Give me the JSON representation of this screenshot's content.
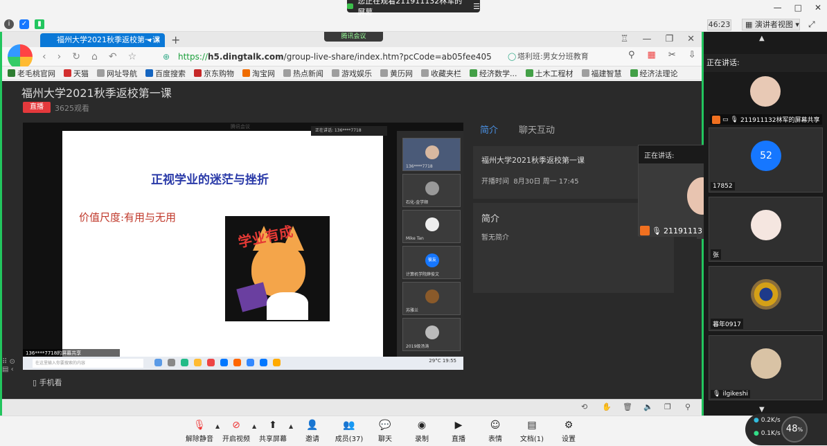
{
  "meeting": {
    "viewing_text": "您正在观看211911132林军的屏幕",
    "timer": "46:23",
    "speaker_view": "演讲者视图",
    "window_controls": [
      "—",
      "□",
      "✕"
    ]
  },
  "browser": {
    "tab_title": "福州大学2021秋季返校第一课",
    "tencent_meeting_pill": "腾讯会议",
    "url_prefix": "https://",
    "url_host": "h5.dingtalk.com",
    "url_rest": "/group-live-share/index.htm?pcCode=ab05fee405",
    "search_text": "塔利班:男女分班教育",
    "bookmarks": [
      {
        "label": "老毛桃官网",
        "color": "#2e7d32"
      },
      {
        "label": "天猫",
        "color": "#d32f2f"
      },
      {
        "label": "网址导航",
        "color": "#9e9e9e"
      },
      {
        "label": "百度搜索",
        "color": "#1565c0"
      },
      {
        "label": "京东购物",
        "color": "#c62828"
      },
      {
        "label": "淘宝网",
        "color": "#ef6c00"
      },
      {
        "label": "热点新闻",
        "color": "#9e9e9e"
      },
      {
        "label": "游戏娱乐",
        "color": "#9e9e9e"
      },
      {
        "label": "黄历网",
        "color": "#9e9e9e"
      },
      {
        "label": "收藏夹栏",
        "color": "#9e9e9e"
      },
      {
        "label": "经济数学...",
        "color": "#43a047"
      },
      {
        "label": "土木工程材",
        "color": "#43a047"
      },
      {
        "label": "福建智慧",
        "color": "#9e9e9e"
      },
      {
        "label": "经济法理论",
        "color": "#43a047"
      }
    ]
  },
  "live": {
    "title": "福州大学2021秋季返校第一课",
    "badge": "直播",
    "viewers": "3625观看",
    "mobile": "手机看",
    "slide_header": "腾讯会议",
    "slide_title": "正视学业的迷茫与挫折",
    "slide_line": "价值尺度:有用与无用",
    "slide_sticker": "学业有成",
    "presenter_label": "136****7718的屏幕共享",
    "video_top_label": "正在讲话: 136****7718",
    "taskbar_search": "在这里输入你要搜索的内容",
    "taskbar_tray": "29°C",
    "taskbar_time": "19:55",
    "thumbs": [
      {
        "name": "136****7718"
      },
      {
        "name": "石化-金学顺"
      },
      {
        "name": "Mike Tan"
      },
      {
        "name": "计算机学院薛俊文"
      },
      {
        "name": "苏雅兰"
      },
      {
        "name": "2019级汤涛"
      }
    ],
    "thumb_badge": "彼友",
    "tabs": [
      "简介",
      "聊天互动"
    ],
    "info_title": "福州大学2021秋季返校第一课",
    "info_time_label": "开播时间",
    "info_time": "8月30日 周一 17:45",
    "intro_title": "简介",
    "intro_text": "暂无简介",
    "speaking_label": "正在讲话:",
    "speaking_name": "21191113"
  },
  "participants": {
    "speaking_label": "正在讲话:",
    "list": [
      {
        "name": "211911132林军的屏幕共享",
        "avatar_color": "#e8c9b5"
      },
      {
        "name": "17852",
        "avatar_text": "52",
        "avatar_color": "#1677ff"
      },
      {
        "name": "张",
        "avatar_color": "#f5e6e0"
      },
      {
        "name": "暮年0917",
        "avatar_color": "#8a6d3b"
      },
      {
        "name": "ilgikeshi",
        "avatar_color": "#d9c3a5"
      }
    ]
  },
  "toolbar": {
    "items": [
      {
        "label": "解除静音",
        "icon": "mic-muted-icon"
      },
      {
        "label": "开启视频",
        "icon": "camera-off-icon"
      },
      {
        "label": "共享屏幕",
        "icon": "share-screen-icon"
      },
      {
        "label": "邀请",
        "icon": "invite-icon"
      },
      {
        "label": "成员(37)",
        "icon": "members-icon"
      },
      {
        "label": "聊天",
        "icon": "chat-icon"
      },
      {
        "label": "录制",
        "icon": "record-icon"
      },
      {
        "label": "直播",
        "icon": "live-icon"
      },
      {
        "label": "表情",
        "icon": "emoji-icon"
      },
      {
        "label": "文档(1)",
        "icon": "document-icon"
      },
      {
        "label": "设置",
        "icon": "settings-icon"
      }
    ]
  },
  "network": {
    "upload": "0.2",
    "upload_unit": "K/s",
    "download": "0.1",
    "download_unit": "K/s",
    "cpu": "48",
    "cpu_unit": "%"
  }
}
